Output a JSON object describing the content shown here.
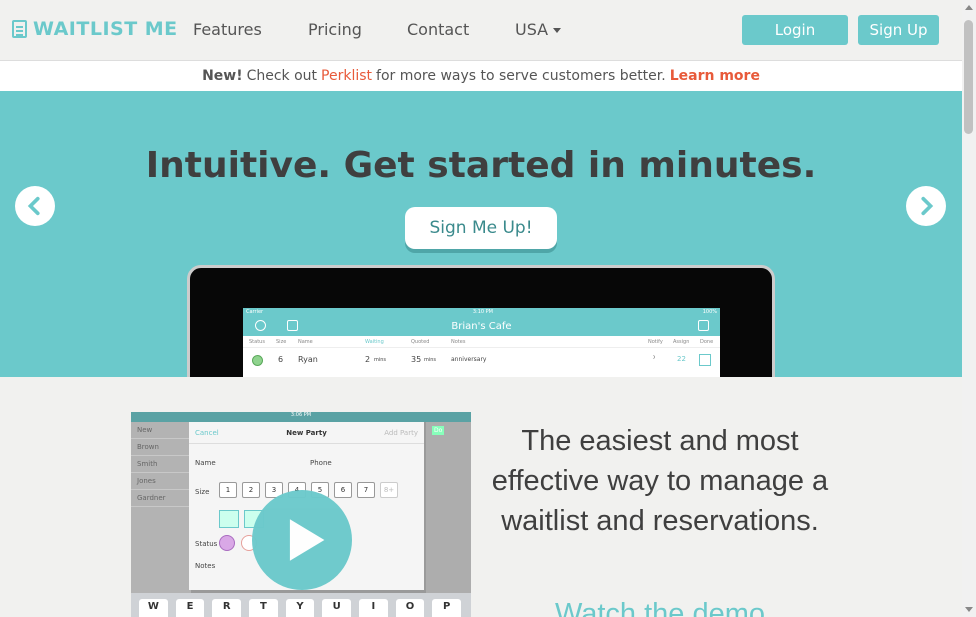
{
  "nav": {
    "logo_text": "WAITLIST ME",
    "links": [
      "Features",
      "Pricing",
      "Contact"
    ],
    "country": "USA",
    "login": "Login",
    "signup": "Sign Up"
  },
  "announcement": {
    "new": "New!",
    "check_out": "Check out",
    "perklist": "Perklist",
    "rest": "for more ways to serve customers better.",
    "learn_more": "Learn more"
  },
  "hero": {
    "title": "Intuitive. Get started in minutes.",
    "button": "Sign Me Up!"
  },
  "app": {
    "carrier": "Carrier",
    "time": "3:10 PM",
    "battery": "100%",
    "title": "Brian's Cafe",
    "columns": [
      "Status",
      "Size",
      "Name",
      "Waiting",
      "Quoted",
      "Notes",
      "Notify",
      "Assign",
      "Done"
    ],
    "row": {
      "size": "6",
      "name": "Ryan",
      "waiting": "2",
      "waiting_unit": "mins",
      "quoted": "35",
      "quoted_unit": "mins",
      "notes": "anniversary",
      "assign": "22"
    }
  },
  "video": {
    "time": "3:06 PM",
    "cancel": "Cancel",
    "title": "New Party",
    "add": "Add Party",
    "done": "Do",
    "sidebar": [
      "New",
      "Brown",
      "Smith",
      "Jones",
      "Gardner"
    ],
    "name_label": "Name",
    "phone_label": "Phone",
    "size_label": "Size",
    "sizes": [
      "1",
      "2",
      "3",
      "4",
      "5",
      "6",
      "7",
      "8+"
    ],
    "status_label": "Status",
    "notes_label": "Notes",
    "keys": [
      "W",
      "E",
      "R",
      "T",
      "Y",
      "U",
      "I",
      "O",
      "P"
    ]
  },
  "tagline": "The easiest and most effective way to manage a waitlist and reservations.",
  "watch": "Watch the demo",
  "colors": {
    "accent": "#6bc9cb",
    "link": "#e85a3a",
    "dark_text": "#3f3f3f"
  }
}
